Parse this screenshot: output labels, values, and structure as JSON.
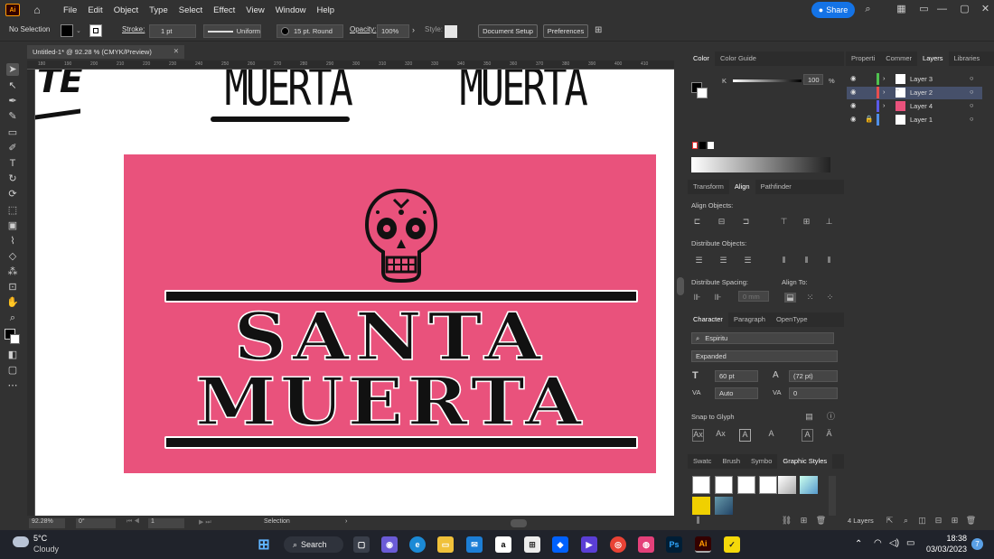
{
  "app": {
    "logo": "Ai",
    "menus": [
      "File",
      "Edit",
      "Object",
      "Type",
      "Select",
      "Effect",
      "View",
      "Window",
      "Help"
    ],
    "share_label": "Share"
  },
  "control_bar": {
    "selection": "No Selection",
    "stroke_label": "Stroke:",
    "stroke_value": "1 pt",
    "profile": "Uniform",
    "brush": "15 pt. Round",
    "opacity_label": "Opacity:",
    "opacity_value": "100%",
    "style_label": "Style:",
    "document_setup": "Document Setup",
    "preferences": "Preferences"
  },
  "document": {
    "tab_title": "Untitled-1* @ 92.28 % (CMYK/Preview)",
    "ruler_ticks": [
      "180",
      "190",
      "200",
      "210",
      "220",
      "230",
      "240",
      "250",
      "260",
      "270",
      "280",
      "290",
      "300",
      "310",
      "320",
      "330",
      "340",
      "350",
      "360",
      "370",
      "380",
      "390",
      "400",
      "410"
    ],
    "zoom": "92.28%",
    "rotation": "0°",
    "artboard": "1",
    "status": "Selection"
  },
  "artwork": {
    "top_word_left": "MUERTA",
    "top_word_right": "MUERTA",
    "cut_word": "TE",
    "line1": "SANTA",
    "line2": "MUERTA",
    "pink": "#e9527c"
  },
  "color_panel": {
    "tabs": [
      "Color",
      "Color Guide"
    ],
    "channel": "K",
    "value": "100",
    "unit": "%"
  },
  "align_panel": {
    "tabs": [
      "Transform",
      "Align",
      "Pathfinder"
    ],
    "align_objects": "Align Objects:",
    "distribute_objects": "Distribute Objects:",
    "distribute_spacing": "Distribute Spacing:",
    "align_to": "Align To:",
    "spacing_value": "0 mm"
  },
  "character_panel": {
    "tabs": [
      "Character",
      "Paragraph",
      "OpenType"
    ],
    "font": "Espiritu",
    "style": "Expanded",
    "size": "60 pt",
    "leading": "(72 pt)",
    "kerning": "Auto",
    "tracking": "0",
    "snap_to_glyph": "Snap to Glyph"
  },
  "styles_panel": {
    "tabs": [
      "Swatc",
      "Brush",
      "Symbo",
      "Graphic Styles"
    ]
  },
  "layers_panel": {
    "tabs": [
      "Properti",
      "Commer",
      "Layers",
      "Libraries"
    ],
    "layers": [
      {
        "name": "Layer 3",
        "color": "#4fc24f",
        "thumb": "plain"
      },
      {
        "name": "Layer 2",
        "color": "#e84e4e",
        "thumb": "dots"
      },
      {
        "name": "Layer 4",
        "color": "#5a5ae8",
        "thumb": "pink"
      },
      {
        "name": "Layer 1",
        "color": "#4f8fe8",
        "thumb": "plain",
        "locked": true
      }
    ],
    "count": "4 Layers"
  },
  "taskbar": {
    "weather_temp": "5°C",
    "weather_desc": "Cloudy",
    "search": "Search",
    "time": "18:38",
    "date": "03/03/2023",
    "notifications": "7"
  }
}
